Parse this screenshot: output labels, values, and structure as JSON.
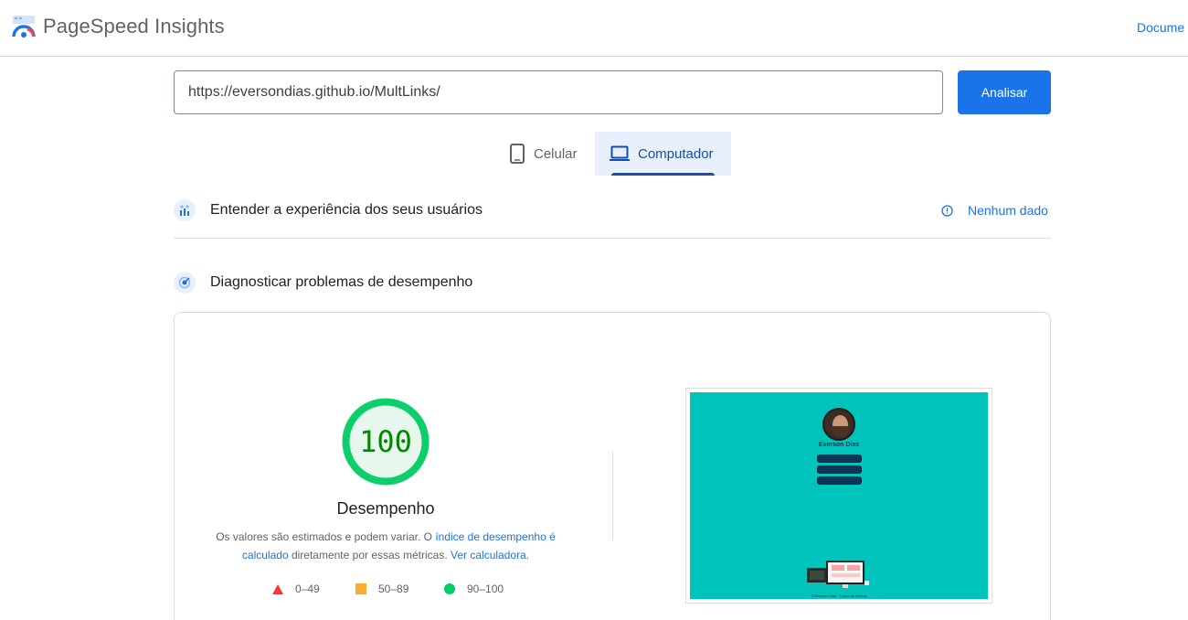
{
  "header": {
    "title": "PageSpeed Insights",
    "docs_link": "Docume"
  },
  "search": {
    "url_value": "https://eversondias.github.io/MultLinks/",
    "analyze_label": "Analisar"
  },
  "device_tabs": [
    {
      "label": "Celular",
      "icon": "smartphone-icon",
      "selected": false
    },
    {
      "label": "Computador",
      "icon": "laptop-icon",
      "selected": true
    }
  ],
  "sections": {
    "experience_title": "Entender a experiência dos seus usuários",
    "no_data_label": "Nenhum dado",
    "diagnose_title": "Diagnosticar problemas de desempenho"
  },
  "performance": {
    "score": "100",
    "score_fraction": 1.0,
    "label": "Desempenho",
    "note_prefix": "Os valores são estimados e podem variar. O ",
    "note_link1": "índice de desempenho é calculado",
    "note_middle": " diretamente por essas métricas. ",
    "note_link2": "Ver calculadora."
  },
  "legend": [
    {
      "range": "0–49",
      "shape": "triangle",
      "color": "#ff3333"
    },
    {
      "range": "50–89",
      "shape": "square",
      "color": "#ffaa33"
    },
    {
      "range": "90–100",
      "shape": "circle",
      "color": "#00cc66"
    }
  ],
  "thumbnail": {
    "name": "Everson Dias",
    "footer": "© Everson Dias · Todos os direitos",
    "background": "#00c4bb"
  },
  "colors": {
    "accent": "#1a73e8",
    "pass": "#0cce6b",
    "pass_fill": "#e6f8ee"
  }
}
